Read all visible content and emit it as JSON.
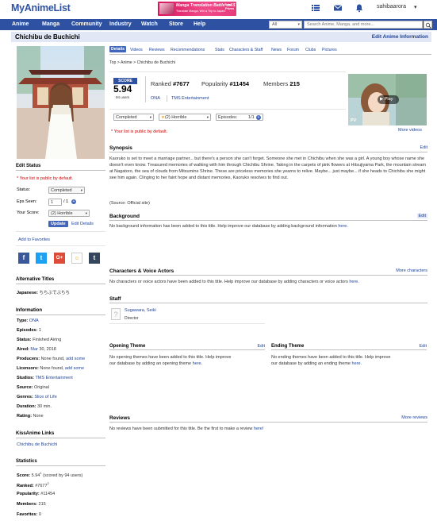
{
  "header": {
    "logo": "MyAnimeList",
    "ad": {
      "title": "Manga Translation Battle vol.1",
      "sub": "Translate Manga, Win a Trip to Japan!",
      "badge": "Total 7 Prizes"
    },
    "username": "sahibaarora"
  },
  "nav": {
    "items": [
      "Anime",
      "Manga",
      "Community",
      "Industry",
      "Watch",
      "Store",
      "Help"
    ],
    "search_category": "All",
    "search_placeholder": "Search Anime, Manga, and more..."
  },
  "title": "Chichibu de Buchichi",
  "edit_anime_link": "Edit Anime Information",
  "tabs": [
    "Details",
    "Videos",
    "Reviews",
    "Recommendations",
    "Stats",
    "Characters & Staff",
    "News",
    "Forum",
    "Clubs",
    "Pictures"
  ],
  "breadcrumb": "Top > Anime > Chichibu de Buchichi",
  "score": {
    "label": "SCORE",
    "value": "5.94",
    "users": "94 users"
  },
  "stats": {
    "ranked_label": "Ranked",
    "ranked": "#7677",
    "popularity_label": "Popularity",
    "popularity": "#11454",
    "members_label": "Members",
    "members": "215"
  },
  "meta": {
    "type": "ONA",
    "studio": "TMS Entertainment"
  },
  "user_status": {
    "status": "Completed",
    "score": "(2) Horrible",
    "episodes_label": "Episodes:",
    "episodes": "1/1",
    "public_note": "* Your list is public by default."
  },
  "video": {
    "play": "Play",
    "pv": "PV",
    "more": "More videos"
  },
  "synopsis": {
    "heading": "Synopsis",
    "edit": "Edit",
    "text": "Kaoruko is set to meet a marriage partner... but there's a person she can't forget. Someone she met in Chichibu when she was a girl. A young boy whose name she doesn't even know. Treasured memories of walking with him through Chichibu Shrine. Taking in the carpets of pink flowers at Hitsujiyama Park, the mountain stream at Nagatoro, the sea of clouds from Mitsumine Shrine. These are priceless memories she yearns to relive. Maybe... just maybe... if she heads to Chichibu she might see him again. Clinging to her faint hope and distant memories, Kaoruko resolves to find out.",
    "source": "(Source: Official site)"
  },
  "background": {
    "heading": "Background",
    "edit": "Edit",
    "text": "No background information has been added to this title. Help improve our database by adding background information",
    "link": "here"
  },
  "characters": {
    "heading": "Characters & Voice Actors",
    "more": "More characters",
    "text": "No characters or voice actors have been added to this title. Help improve our database by adding characters or voice actors",
    "link": "here"
  },
  "staff": {
    "heading": "Staff",
    "name": "Sugawara, Seiki",
    "role": "Director"
  },
  "opening": {
    "heading": "Opening Theme",
    "edit": "Edit",
    "line1": "No opening themes have been added to this title. Help improve",
    "line2": "our database by adding an opening theme",
    "link": "here"
  },
  "ending": {
    "heading": "Ending Theme",
    "edit": "Edit",
    "line1": "No ending themes have been added to this title. Help improve",
    "line2": "our database by adding an ending theme",
    "link": "here"
  },
  "reviews": {
    "heading": "Reviews",
    "more": "More reviews",
    "text": "No reviews have been submitted for this title. Be the first to make a review",
    "link": "here!"
  },
  "left": {
    "edit_status_heading": "Edit Status",
    "public_note": "* Your list is public by default.",
    "status_label": "Status:",
    "status_value": "Completed",
    "eps_label": "Eps Seen:",
    "eps_value": "1",
    "eps_total": "/ 1",
    "score_label": "Your Score:",
    "score_value": "(2) Horrible",
    "update_button": "Update",
    "edit_details": "Edit Details",
    "add_favorites": "Add to Favorites",
    "alt_titles_heading": "Alternative Titles",
    "japanese_label": "Japanese:",
    "japanese_value": "ちちぶでぶちち",
    "information_heading": "Information",
    "info": {
      "type_label": "Type:",
      "type": "ONA",
      "episodes_label": "Episodes:",
      "episodes": "1",
      "status_label": "Status:",
      "status": "Finished Airing",
      "aired_label": "Aired:",
      "aired_month": "Mar",
      "aired_day": "30, 2018",
      "producers_label": "Producers:",
      "producers": "None found,",
      "producers_add": "add some",
      "licensors_label": "Licensors:",
      "licensors": "None found,",
      "licensors_add": "add some",
      "studios_label": "Studios:",
      "studios": "TMS Entertainment",
      "source_label": "Source:",
      "source": "Original",
      "genres_label": "Genres:",
      "genres": "Slice of Life",
      "duration_label": "Duration:",
      "duration": "30 min.",
      "rating_label": "Rating:",
      "rating": "None"
    },
    "kissanime_heading": "KissAnime Links",
    "kissanime_link": "Chichibu de Buchichi",
    "statistics_heading": "Statistics",
    "stats": {
      "score_label": "Score:",
      "score": "5.94",
      "score_sup": "1",
      "score_note": "(scored by 94 users)",
      "ranked_label": "Ranked:",
      "ranked": "#7677",
      "ranked_sup": "2",
      "popularity_label": "Popularity:",
      "popularity": "#11454",
      "members_label": "Members:",
      "members": "215",
      "favorites_label": "Favorites:",
      "favorites": "0"
    }
  },
  "colors": {
    "brand": "#2e51a2",
    "link": "#1d439b",
    "title_bar": "#e1e7f5",
    "note_red": "#d40000"
  }
}
